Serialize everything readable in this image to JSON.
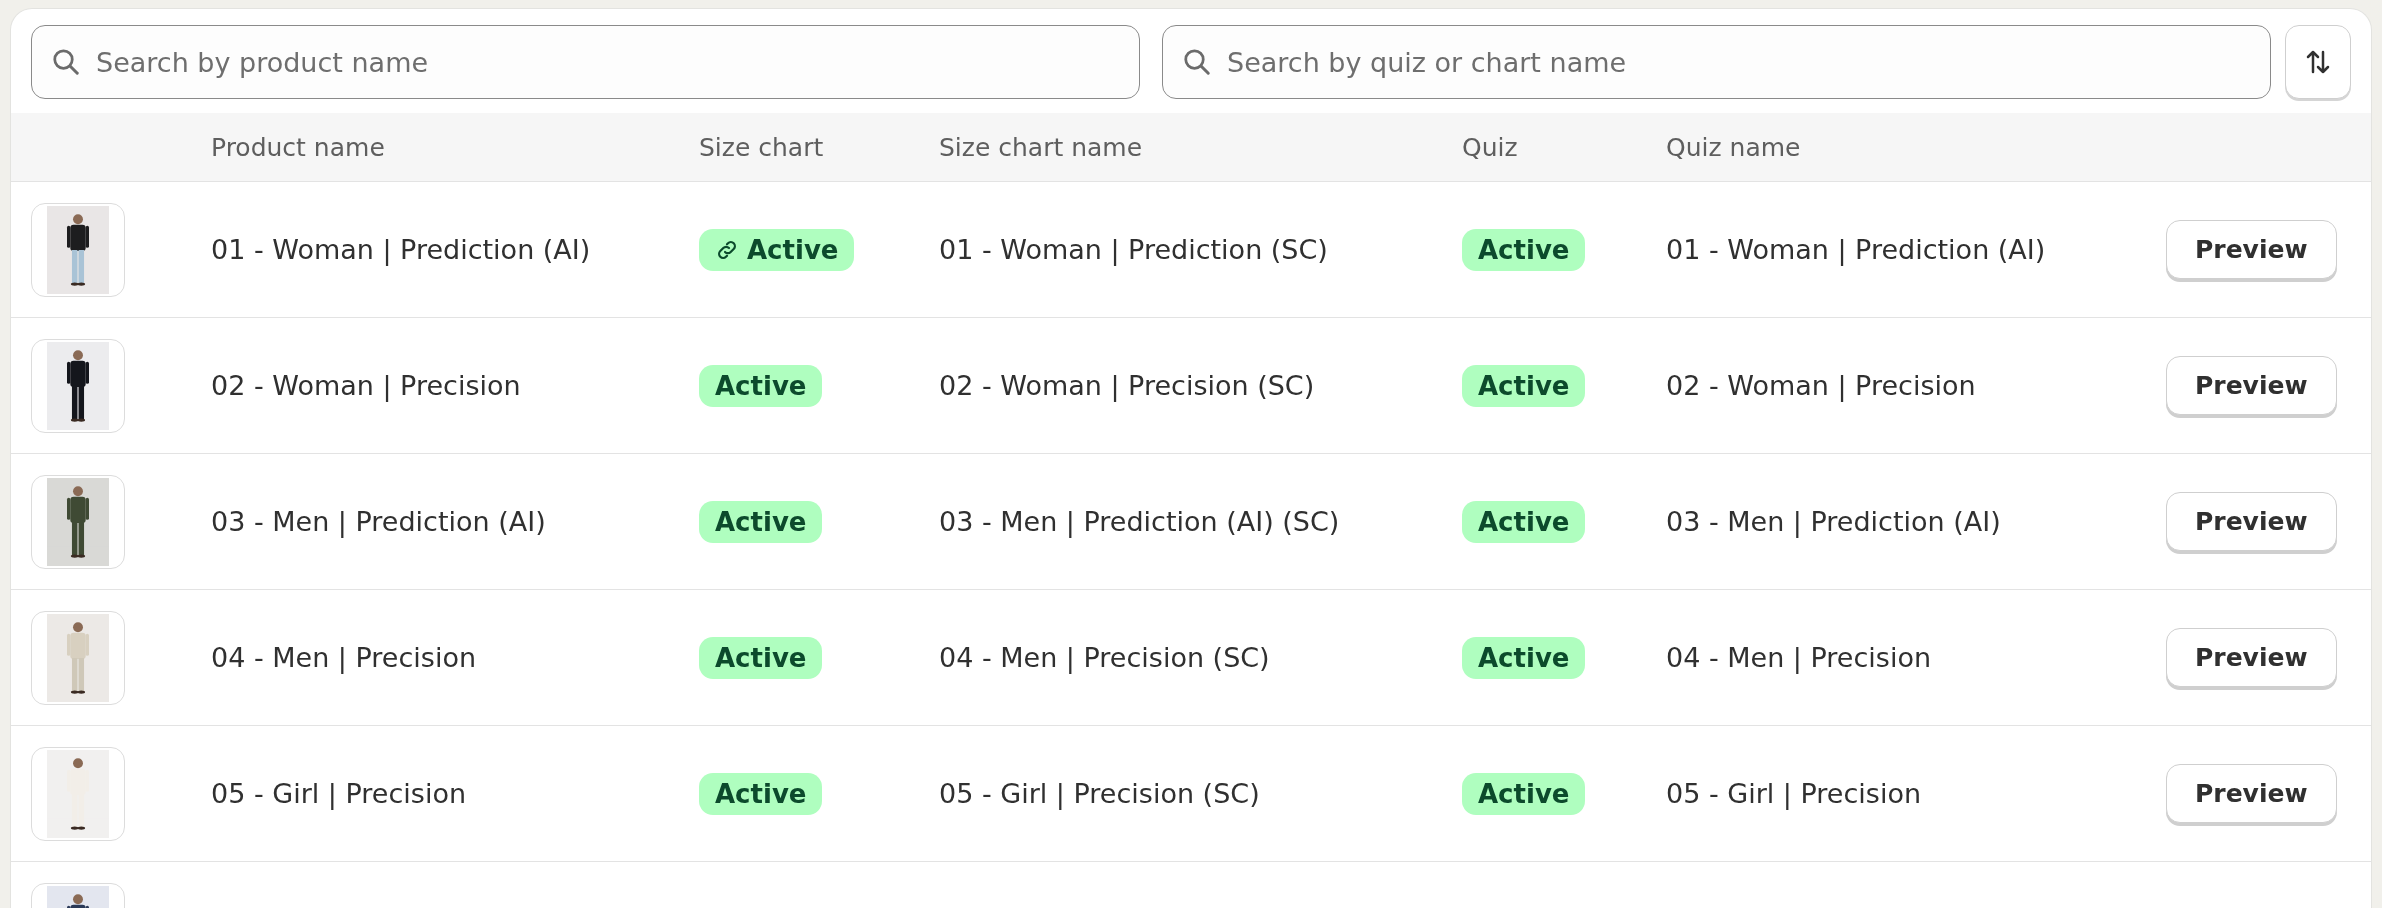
{
  "search_fields": [
    {
      "placeholder": "Search by product name"
    },
    {
      "placeholder": "Search by quiz or chart name"
    }
  ],
  "table": {
    "columns": [
      "Product name",
      "Size chart",
      "Size chart name",
      "Quiz",
      "Quiz name"
    ],
    "rows": [
      {
        "thumbnail": {
          "kind": "picture"
        },
        "product_name": "01 - Woman | Prediction (AI)",
        "size_chart": {
          "label": "Active",
          "linked": true
        },
        "size_chart_name": "01 - Woman | Prediction (SC)",
        "quiz": {
          "label": "Active"
        },
        "quiz_name": "01 - Woman | Prediction (AI)",
        "action": "Preview"
      },
      {
        "thumbnail": {
          "kind": "picture"
        },
        "product_name": "02 - Woman | Precision",
        "size_chart": {
          "label": "Active",
          "linked": false
        },
        "size_chart_name": "02 - Woman | Precision (SC)",
        "quiz": {
          "label": "Active"
        },
        "quiz_name": "02 - Woman | Precision",
        "action": "Preview"
      },
      {
        "thumbnail": {
          "kind": "picture"
        },
        "product_name": "03 - Men | Prediction (AI)",
        "size_chart": {
          "label": "Active",
          "linked": false
        },
        "size_chart_name": "03 - Men | Prediction (AI) (SC)",
        "quiz": {
          "label": "Active"
        },
        "quiz_name": "03 - Men | Prediction (AI)",
        "action": "Preview"
      },
      {
        "thumbnail": {
          "kind": "picture"
        },
        "product_name": "04 - Men | Precision",
        "size_chart": {
          "label": "Active",
          "linked": false
        },
        "size_chart_name": "04 - Men | Precision (SC)",
        "quiz": {
          "label": "Active"
        },
        "quiz_name": "04 - Men | Precision",
        "action": "Preview"
      },
      {
        "thumbnail": {
          "kind": "picture"
        },
        "product_name": "05 - Girl | Precision",
        "size_chart": {
          "label": "Active",
          "linked": false
        },
        "size_chart_name": "05 - Girl | Precision (SC)",
        "quiz": {
          "label": "Active"
        },
        "quiz_name": "05 - Girl | Precision",
        "action": "Preview"
      },
      {
        "thumbnail": {
          "kind": "picture"
        }
      }
    ]
  }
}
